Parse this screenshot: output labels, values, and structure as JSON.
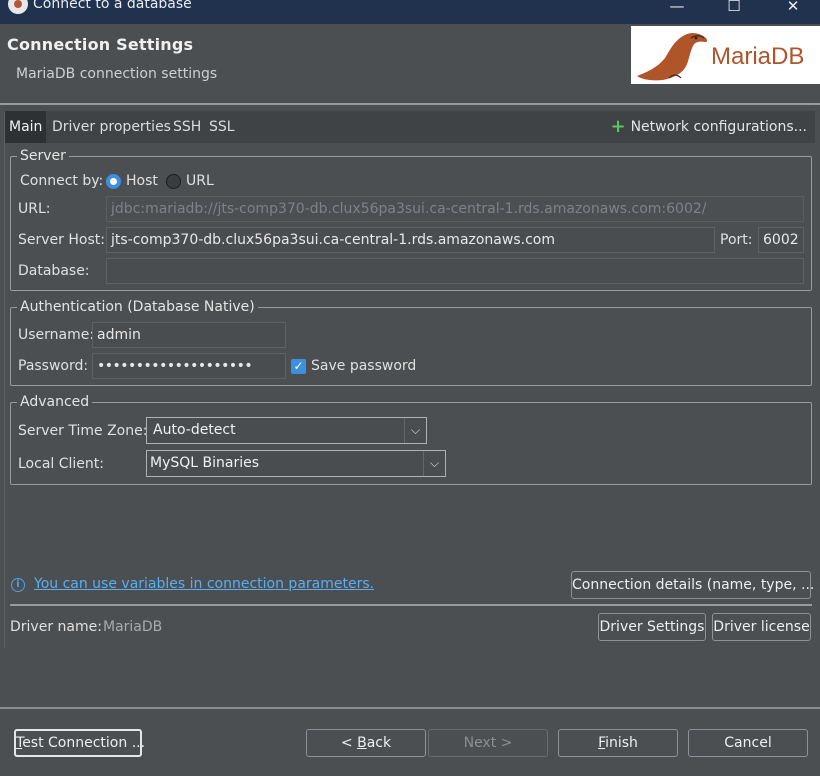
{
  "window": {
    "title": "Connect to a database",
    "minimize_glyph": "—",
    "maximize_glyph": "☐",
    "close_glyph": "✕"
  },
  "header": {
    "title": "Connection Settings",
    "subtitle": "MariaDB connection settings",
    "logo_text": "MariaDB"
  },
  "tabs": [
    {
      "label": "Main",
      "active": true
    },
    {
      "label": "Driver properties",
      "active": false
    },
    {
      "label": "SSH",
      "active": false
    },
    {
      "label": "SSL",
      "active": false
    }
  ],
  "network_configurations": {
    "icon": "plus-icon",
    "label": "Network configurations..."
  },
  "server": {
    "legend": "Server",
    "connect_by_label": "Connect by:",
    "host_option": "Host",
    "url_option": "URL",
    "selected": "Host",
    "url_label": "URL:",
    "url_value": "jdbc:mariadb://jts-comp370-db.clux56pa3sui.ca-central-1.rds.amazonaws.com:6002/",
    "host_label": "Server Host:",
    "host_value": "jts-comp370-db.clux56pa3sui.ca-central-1.rds.amazonaws.com",
    "port_label": "Port:",
    "port_value": "6002",
    "database_label": "Database:",
    "database_value": ""
  },
  "authentication": {
    "legend": "Authentication (Database Native)",
    "username_label": "Username:",
    "username_value": "admin",
    "password_label": "Password:",
    "password_value": "••••••••••••••••••••",
    "save_password_label": "Save password",
    "save_password_checked": true
  },
  "advanced": {
    "legend": "Advanced",
    "timezone_label": "Server Time Zone:",
    "timezone_value": "Auto-detect",
    "local_client_label": "Local Client:",
    "local_client_value": "MySQL Binaries"
  },
  "info": {
    "link_text": "You can use variables in connection parameters.",
    "connection_details_button": "Connection details (name, type, ... )"
  },
  "driver": {
    "name_label": "Driver name:",
    "name_value": "MariaDB",
    "settings_button": "Driver Settings",
    "license_button": "Driver license"
  },
  "footer": {
    "test_connection_mnemonic": "T",
    "test_connection_rest": "est Connection ...",
    "back_prefix": "< ",
    "back_mnemonic": "B",
    "back_rest": "ack",
    "next": "Next >",
    "finish_mnemonic": "F",
    "finish_rest": "inish",
    "cancel": "Cancel"
  },
  "colors": {
    "accent": "#3d8fe0",
    "link": "#5aaef0",
    "titlebar": "#20324d",
    "background": "#4b4f52",
    "logo_brand": "#b0542a"
  }
}
